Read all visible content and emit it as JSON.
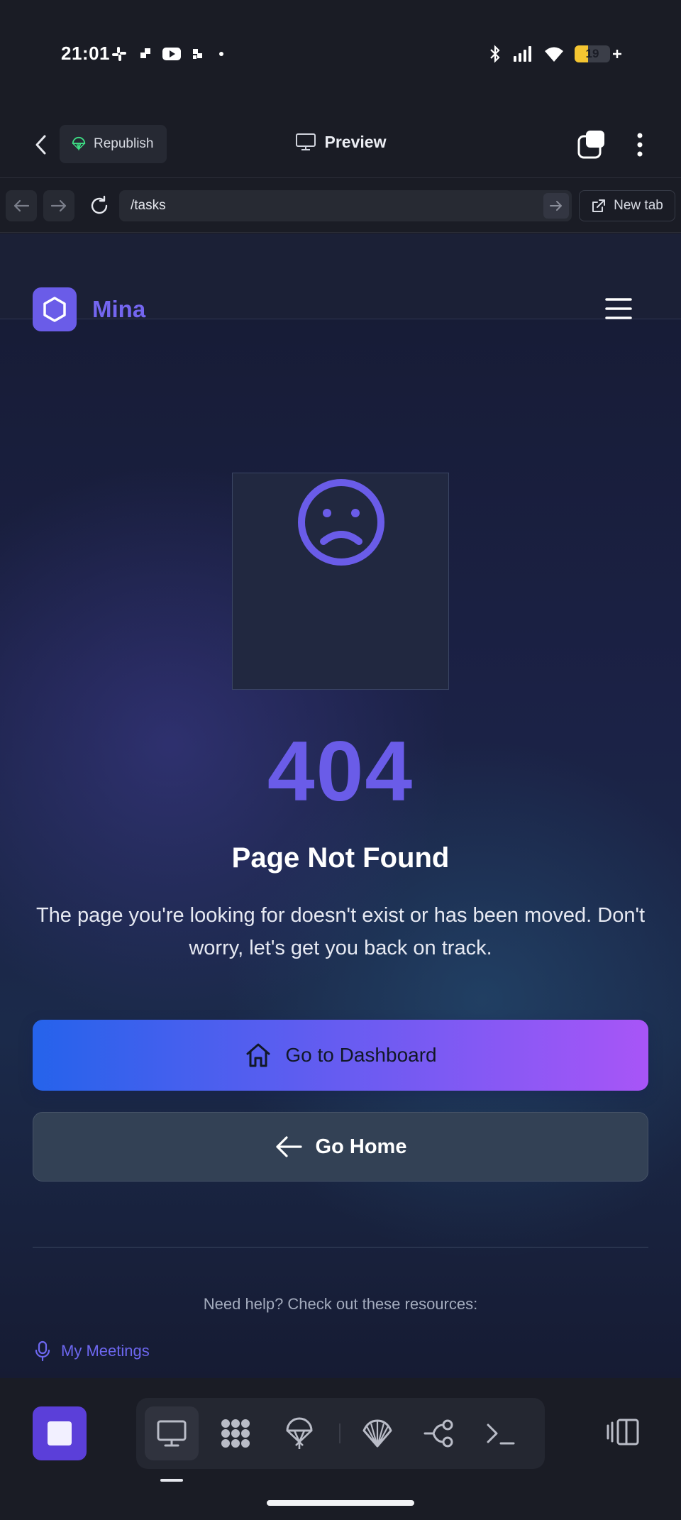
{
  "status_bar": {
    "time": "21:01",
    "app_icons": [
      "slack-icon",
      "grid-icon",
      "youtube-icon",
      "grid-small-icon",
      "dot-icon"
    ],
    "battery": "19",
    "battery_level": 0.19,
    "indicators": [
      "bluetooth-icon",
      "signal-icon",
      "wifi-icon",
      "battery-icon"
    ]
  },
  "app_bar": {
    "republish_label": "Republish",
    "preview_label": "Preview"
  },
  "browser": {
    "url": "/tasks",
    "new_tab_label": "New tab"
  },
  "site": {
    "name": "Mina",
    "accent_color": "#6a5ce8"
  },
  "error": {
    "code": "404",
    "title": "Page Not Found",
    "description": "The page you're looking for doesn't exist or has been moved. Don't worry, let's get you back on track.",
    "primary_button": "Go to Dashboard",
    "secondary_button": "Go Home",
    "help_text": "Need help? Check out these resources:",
    "resource_link": "My Meetings"
  },
  "dock": {
    "tools": [
      "monitor-icon",
      "apps-icon",
      "deploy-icon",
      "shell-icon",
      "branch-icon",
      "terminal-icon"
    ],
    "active_tool": "monitor-icon"
  }
}
